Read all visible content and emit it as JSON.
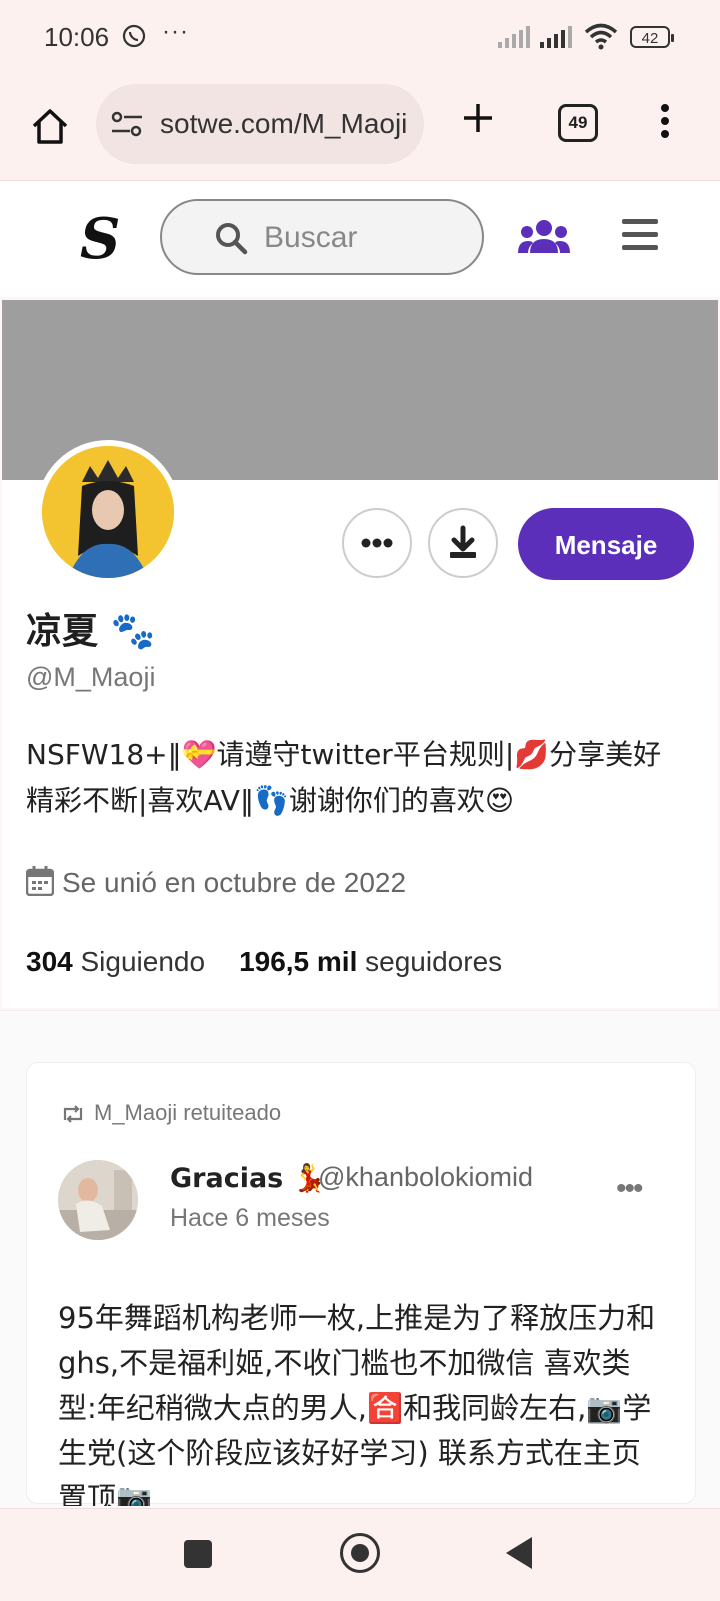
{
  "status_bar": {
    "time": "10:06",
    "more": "···",
    "battery": "42"
  },
  "browser": {
    "url": "sotwe.com/M_Maoji",
    "tab_count": "49"
  },
  "site_header": {
    "logo": "S",
    "search_placeholder": "Buscar"
  },
  "profile": {
    "name": "凉夏 🐾",
    "handle": "@M_Maoji",
    "bio": "NSFW18+‖💝请遵守twitter平台规则|💋分享美好精彩不断|喜欢AV‖👣谢谢你们的喜欢😍",
    "joined": "Se unió en octubre de 2022",
    "following_count": "304",
    "following_label": "Siguiendo",
    "followers_count": "196,5 mil",
    "followers_label": "seguidores",
    "message_button": "Mensaje"
  },
  "tweet": {
    "retweet_label": "M_Maoji retuiteado",
    "author_name": "Gracias 💃",
    "author_handle": "@khanbolokiomid",
    "time": "Hace 6 meses",
    "more": "•••",
    "text": "95年舞蹈机构老师一枚,上推是为了释放压力和ghs,不是福利姬,不收门槛也不加微信 喜欢类型:年纪稍微大点的男人,🈴和我同龄左右,📷学生党(这个阶段应该好好学习) 联系方式在主页置顶📷"
  },
  "colors": {
    "accent": "#5b2fba",
    "banner": "#9e9e9e",
    "chrome_bg": "#fdf1f0"
  }
}
